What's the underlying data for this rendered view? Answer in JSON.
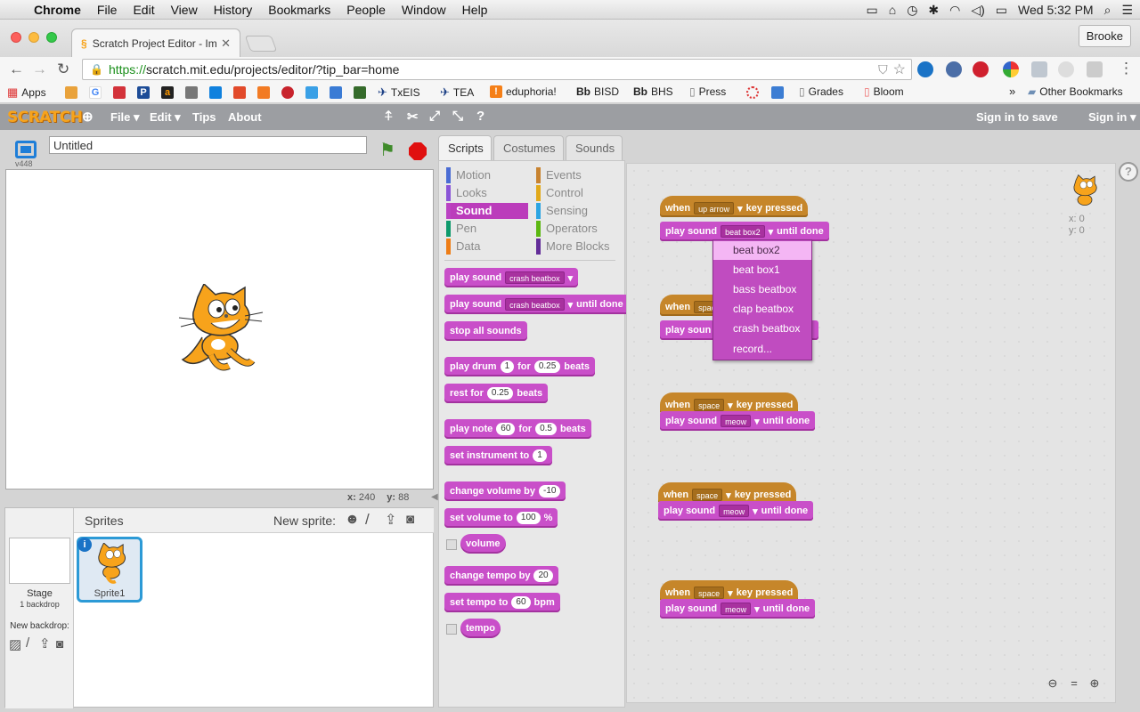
{
  "macmenu": {
    "app": "Chrome",
    "items": [
      "File",
      "Edit",
      "View",
      "History",
      "Bookmarks",
      "People",
      "Window",
      "Help"
    ],
    "clock": "Wed 5:32 PM"
  },
  "browser": {
    "tab_title": "Scratch Project Editor - Im",
    "profile": "Brooke",
    "url_scheme": "https://",
    "url_rest": "scratch.mit.edu/projects/editor/?tip_bar=home",
    "bookmarks": [
      "Apps",
      "TxEIS",
      "TEA",
      "eduphoria!",
      "BISD",
      "BHS",
      "Press",
      "Grades",
      "Bloom"
    ],
    "bookmark_prefix_bb": "Bb",
    "other_bookmarks": "Other Bookmarks"
  },
  "scratch": {
    "logo": "SCRATCH",
    "menu": [
      "File ▾",
      "Edit ▾",
      "Tips",
      "About"
    ],
    "sign_in_save": "Sign in to save",
    "sign_in": "Sign in ▾",
    "project_title": "Untitled",
    "version": "v448",
    "coords": {
      "x_label": "x:",
      "x": "240",
      "y_label": "y:",
      "y": "88"
    },
    "sprites_label": "Sprites",
    "new_sprite_label": "New sprite:",
    "stage_label": "Stage",
    "stage_backdrops": "1 backdrop",
    "new_backdrop_label": "New backdrop:",
    "sprite1_name": "Sprite1",
    "tabs": [
      "Scripts",
      "Costumes",
      "Sounds"
    ],
    "categories_left": [
      "Motion",
      "Looks",
      "Sound",
      "Pen",
      "Data"
    ],
    "categories_right": [
      "Events",
      "Control",
      "Sensing",
      "Operators",
      "More Blocks"
    ],
    "category_colors": {
      "Motion": "#4a6cd4",
      "Looks": "#8a55d7",
      "Sound": "#bb42c3",
      "Pen": "#0e9a6c",
      "Data": "#ee7d16",
      "Events": "#c88330",
      "Control": "#e1a91a",
      "Sensing": "#2ca5e2",
      "Operators": "#5cb712",
      "More Blocks": "#632d99"
    },
    "palette": {
      "play_sound": "play sound",
      "until_done": "until done",
      "crash_beatbox": "crash beatbox",
      "stop_all_sounds": "stop all sounds",
      "play_drum": "play drum",
      "drum_val": "1",
      "for": "for",
      "beats": "beats",
      "drum_beats": "0.25",
      "rest_for": "rest for",
      "rest_val": "0.25",
      "play_note": "play note",
      "note_val": "60",
      "note_beats": "0.5",
      "set_instrument": "set instrument to",
      "instrument_val": "1",
      "change_volume": "change volume by",
      "volume_change_val": "-10",
      "set_volume": "set volume to",
      "volume_val": "100",
      "percent": "%",
      "volume": "volume",
      "change_tempo": "change tempo by",
      "tempo_change_val": "20",
      "set_tempo": "set tempo to",
      "tempo_val": "60",
      "bpm": "bpm",
      "tempo": "tempo"
    },
    "scripts": {
      "when": "when",
      "key_pressed": "key pressed",
      "up_arrow": "up arrow",
      "space": "space",
      "beat_box2": "beat box2",
      "meow": "meow",
      "play_sound": "play sound",
      "until_done": "until done",
      "truncated_space": "spac",
      "truncated_play": "play soun"
    },
    "sprite_info": {
      "x": "x: 0",
      "y": "y: 0"
    },
    "sound_menu": [
      "beat box2",
      "beat box1",
      "bass beatbox",
      "clap beatbox",
      "crash beatbox",
      "record..."
    ]
  }
}
